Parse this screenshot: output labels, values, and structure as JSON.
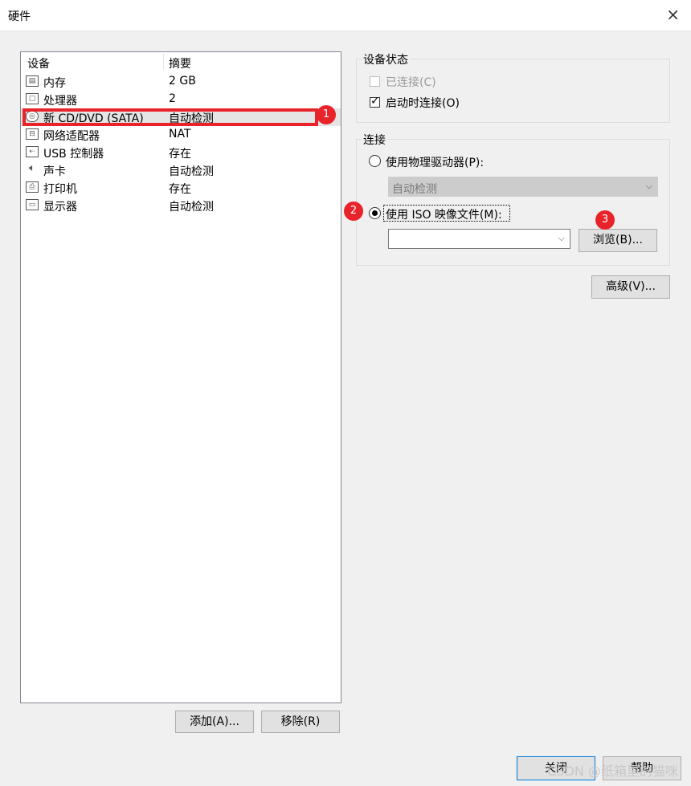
{
  "window": {
    "title": "硬件",
    "close_glyph": "×"
  },
  "device_list": {
    "col_device": "设备",
    "col_summary": "摘要",
    "rows": [
      {
        "name": "内存",
        "summary": "2 GB",
        "icon": "memory-icon"
      },
      {
        "name": "处理器",
        "summary": "2",
        "icon": "processor-icon"
      },
      {
        "name": "新 CD/DVD (SATA)",
        "summary": "自动检测",
        "icon": "cd-dvd-icon",
        "selected": true
      },
      {
        "name": "网络适配器",
        "summary": "NAT",
        "icon": "network-adapter-icon"
      },
      {
        "name": "USB 控制器",
        "summary": "存在",
        "icon": "usb-icon"
      },
      {
        "name": "声卡",
        "summary": "自动检测",
        "icon": "speaker-icon"
      },
      {
        "name": "打印机",
        "summary": "存在",
        "icon": "printer-icon"
      },
      {
        "name": "显示器",
        "summary": "自动检测",
        "icon": "monitor-icon"
      }
    ]
  },
  "buttons": {
    "add": "添加(A)...",
    "remove": "移除(R)",
    "browse": "浏览(B)...",
    "advanced": "高级(V)...",
    "close": "关闭",
    "help": "帮助"
  },
  "device_status": {
    "title": "设备状态",
    "connected_label": "已连接(C)",
    "connected_checked": false,
    "connect_on_start_label": "启动时连接(O)",
    "connect_on_start_checked": true
  },
  "connection": {
    "title": "连接",
    "physical_label": "使用物理驱动器(P):",
    "physical_value": "自动检测",
    "iso_label": "使用 ISO 映像文件(M):",
    "iso_value": "",
    "selected": "iso"
  },
  "annotations": {
    "badge1": "1",
    "badge2": "2",
    "badge3": "3",
    "color": "#e8232a"
  },
  "watermark": "CSDN @纸箱里的猫咪"
}
